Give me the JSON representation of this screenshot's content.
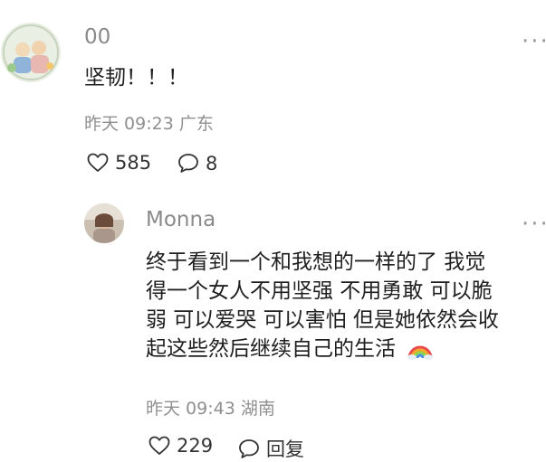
{
  "comments": [
    {
      "username": "00",
      "text": "坚韧！！！",
      "time": "昨天 09:23",
      "location": "广东",
      "likes": "585",
      "replies": "8"
    },
    {
      "username": "Monna",
      "lines": [
        "终于看到一个和我想的一样的了 我觉",
        "得一个女人不用坚强 不用勇敢 可以脆",
        "弱 可以爱哭 可以害怕 但是她依然会收",
        "起这些然后继续自己的生活"
      ],
      "emoji": "rainbow",
      "time": "昨天 09:43",
      "location": "湖南",
      "likes": "229",
      "reply_label": "回复"
    }
  ],
  "more_label": "···"
}
